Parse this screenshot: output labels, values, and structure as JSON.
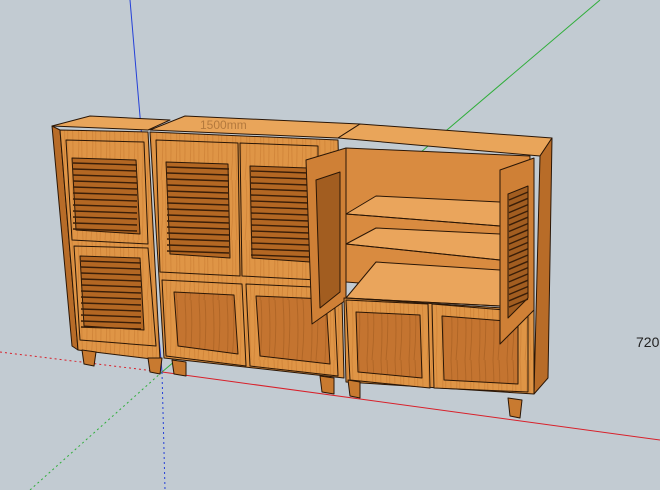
{
  "viewport": {
    "background": "#c2cbd2",
    "dimension_label": "720",
    "faint_dimension_label": "1500mm"
  },
  "axes": {
    "red": "#d8202a",
    "green": "#2fae3a",
    "blue": "#2440d8"
  },
  "model": {
    "wood_light": "#e39a49",
    "wood_mid": "#c87a30",
    "wood_dark": "#8f4f16",
    "edge": "#2a1606"
  }
}
